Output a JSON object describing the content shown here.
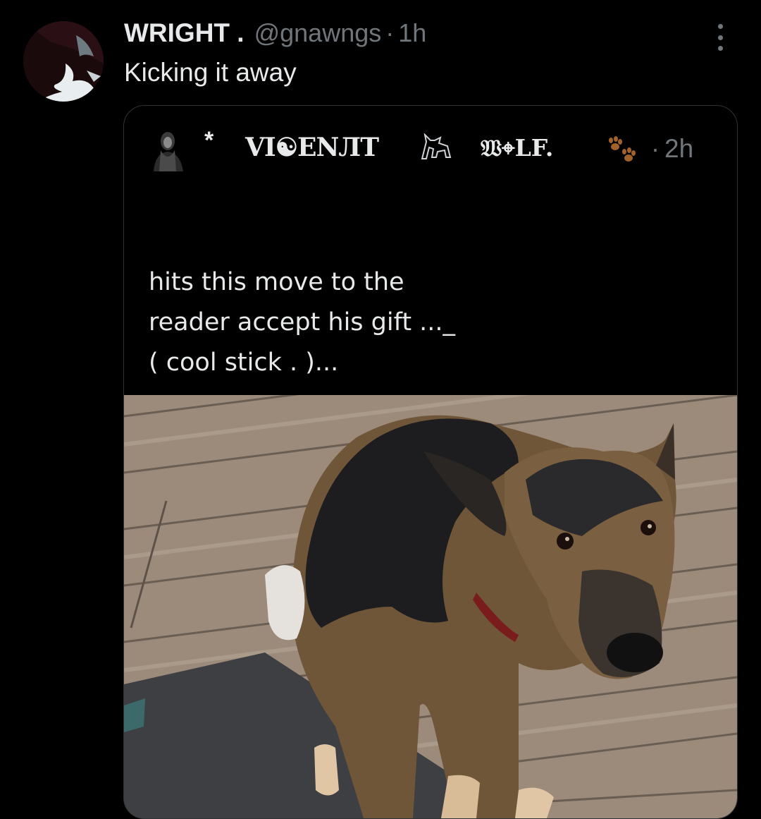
{
  "tweet": {
    "display_name": "WRIGHT .",
    "handle": "@gnawngs",
    "separator": "·",
    "time": "1h",
    "text": "Kicking it away",
    "avatar_icon": "avatar-image",
    "more_icon": "more-dots-icon"
  },
  "quoted_tweet": {
    "star": "*",
    "display_name_part1": "VI☯ENЛT",
    "wolf_glyph": "wolf-emoji-icon",
    "display_name_part2": "𝔚⌖LF.",
    "paw_icon": "paw-prints-emoji-icon",
    "separator": "·",
    "time": "2h",
    "text": "hits this move to the\nreader accept his gift ..._\n( cool stick . )...",
    "media": "photo of a german shepherd dog sitting on a wooden deck"
  },
  "colors": {
    "background": "#000000",
    "primary_text": "#e7e9ea",
    "secondary_text": "#71767b",
    "border": "#2f3336"
  }
}
